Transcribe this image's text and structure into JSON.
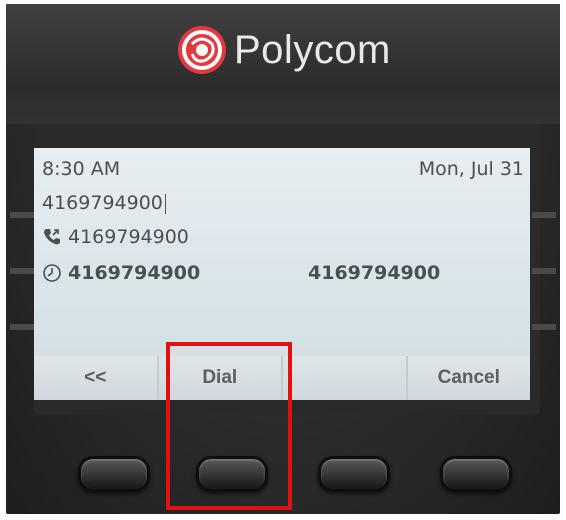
{
  "brand": {
    "name": "Polycom",
    "logo_icon": "polycom-logo-icon"
  },
  "status_bar": {
    "time": "8:30 AM",
    "date": "Mon, Jul 31"
  },
  "dial_entry": {
    "value": "4169794900"
  },
  "call_log": {
    "icon": "phone-icon",
    "number": "4169794900"
  },
  "suggestions": [
    {
      "icon": "clock-icon",
      "number": "4169794900"
    },
    {
      "number": "4169794900"
    }
  ],
  "softkeys": {
    "back_label": "<<",
    "dial_label": "Dial",
    "blank_label": "",
    "cancel_label": "Cancel"
  },
  "colors": {
    "screen": "#dde6ea",
    "bezel": "#2f2f2f",
    "highlight": "#e31010"
  }
}
